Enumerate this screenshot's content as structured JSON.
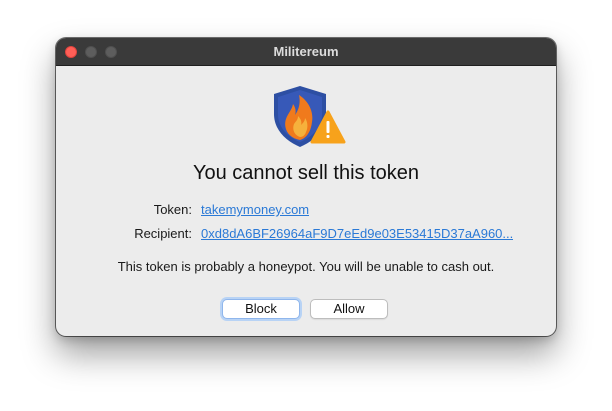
{
  "window": {
    "title": "Militereum"
  },
  "dialog": {
    "icon": "shield-flame-warning-icon",
    "heading": "You cannot sell this token",
    "details": [
      {
        "label": "Token:",
        "value": "takemymoney.com"
      },
      {
        "label": "Recipient:",
        "value": "0xd8dA6BF26964aF9D7eEd9e03E53415D37aA960..."
      }
    ],
    "message": "This token is probably a honeypot. You will be unable to cash out.",
    "buttons": {
      "block_label": "Block",
      "allow_label": "Allow"
    }
  },
  "colors": {
    "link": "#2a79d6",
    "shield_blue": "#2d4fa3",
    "flame_orange": "#f07a1c",
    "warning_yellow": "#f7a21b",
    "titlebar": "#3a3a3a",
    "close_button": "#ff5f57"
  }
}
